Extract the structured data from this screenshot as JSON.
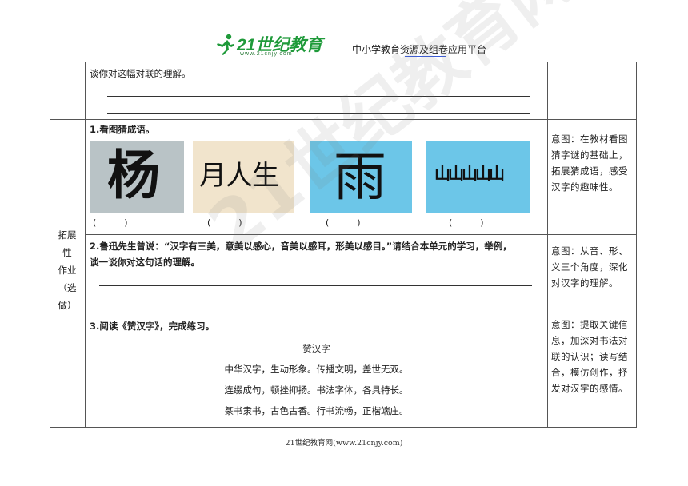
{
  "header": {
    "logo_text": "21世纪教育",
    "logo_sub": "www.21cnjy.com",
    "tagline": "中小学教育资源及组卷应用平台"
  },
  "row_top": {
    "prompt": "谈你对这幅对联的理解。"
  },
  "side_label": [
    "拓展",
    "性",
    "作业",
    "（选",
    "做）"
  ],
  "q1": {
    "title": "1.看图猜成语。",
    "pictures": [
      {
        "glyph": "杨",
        "caption": "( )",
        "bg": "#b9c3c6"
      },
      {
        "glyph": "月人生",
        "caption": "( )",
        "bg": "#f1e4cc"
      },
      {
        "glyph": "雨",
        "caption": "( )",
        "bg": "#6cc6e8"
      },
      {
        "glyph": "山山山山山",
        "caption": "( )",
        "bg": "#6cc6e8"
      }
    ],
    "paren_marks": [
      "(          )",
      "(          )",
      "(          )",
      "(          )"
    ],
    "note": "意图：在教材看图猜字谜的基础上，拓展猜成语，感受汉字的趣味性。"
  },
  "q2": {
    "title": "2.鲁迅先生曾说：“汉字有三美，意美以感心，音美以感耳，形美以感目。”请结合本单元的学习，举例，",
    "title_cont": "谈一谈你对这句话的理解。",
    "note": "意图：从音、形、义三个角度，深化对汉字的理解。"
  },
  "q3": {
    "title": "3.阅读《赞汉字》，完成练习。",
    "poem_title": "赞汉字",
    "poem_lines": [
      "中华汉字，生动形象。传播文明，盖世无双。",
      "连缀成句，顿挫抑扬。书法字体，各具特长。",
      "篆书隶书，古色古香。行书流畅，正楷端庄。"
    ],
    "note": "意图：提取关键信息，加深对书法对联的认识；读写结合，模仿创作，抒发对汉字的感情。"
  },
  "footer": "21世纪教育网(www.21cnjy.com)",
  "watermark": "21世纪教育网精品资料",
  "colors": {
    "logo_green": "#1f9a3a",
    "grid": "#555555"
  }
}
